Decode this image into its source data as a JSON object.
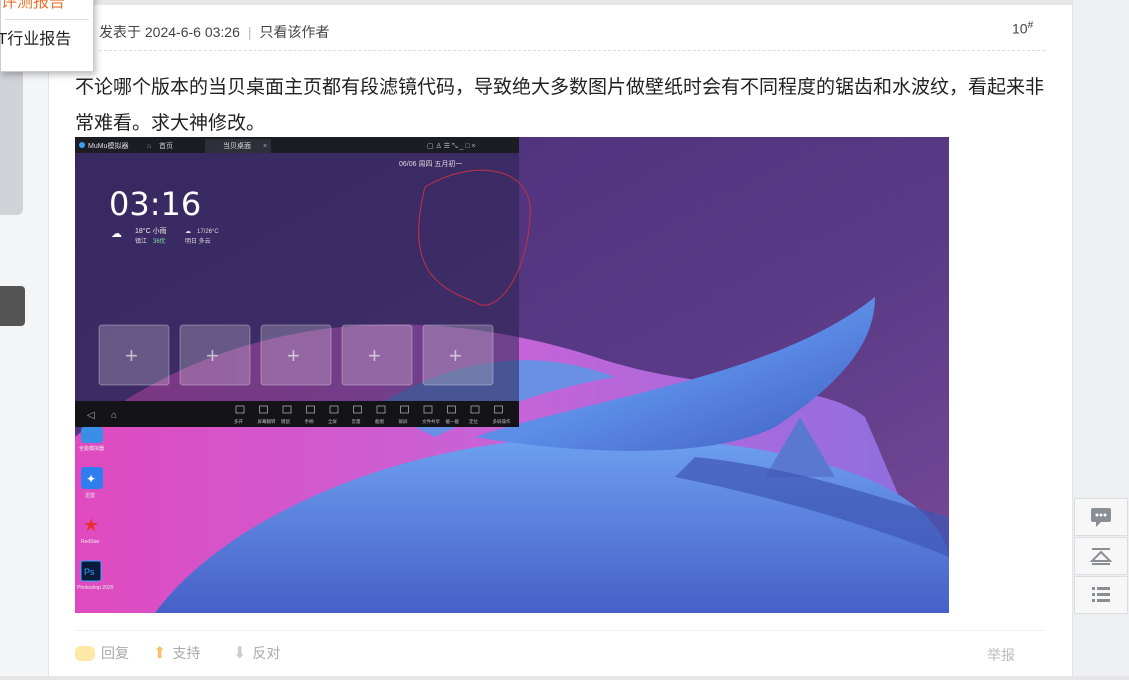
{
  "dropdown": {
    "item1": "评测报告",
    "item2": "IT行业报告"
  },
  "post": {
    "meta": {
      "posted_prefix": "发表于 2024-6-6 03:26",
      "author_only": "只看该作者"
    },
    "floor": "10",
    "floor_sup": "#",
    "content": "不论哪个版本的当贝桌面主页都有段滤镜代码，导致绝大多数图片做壁纸时会有不同程度的锯齿和水波纹，看起来非常难看。求大神修改。"
  },
  "screenshot": {
    "emulator_title": "MuMu模拟器",
    "tab_home": "首页",
    "tab_launcher": "当贝桌面",
    "time": "03:16",
    "date_line": "06/06  周四  五月初一",
    "weather_temp": "18°C 小雨",
    "weather_city": "镇江",
    "weather_aqi": "36优",
    "weather_tomorrow_temp": "17/26°C",
    "weather_tomorrow": "明日  多云",
    "toolbar_labels": [
      "多开",
      "屏幕翻转",
      "键鼠",
      "手柄",
      "全屏",
      "音量",
      "截图",
      "裁屏",
      "文件共享",
      "截一截",
      "定位",
      "多屏操作"
    ],
    "desktop_icons": [
      "全能模拟器",
      "迅雷",
      "RedStar",
      "Photoshop 2020"
    ]
  },
  "actions": {
    "reply": "回复",
    "support": "支持",
    "oppose": "反对",
    "report": "举报"
  },
  "side_icons": [
    "comment-icon",
    "back-to-top-icon",
    "list-icon"
  ]
}
